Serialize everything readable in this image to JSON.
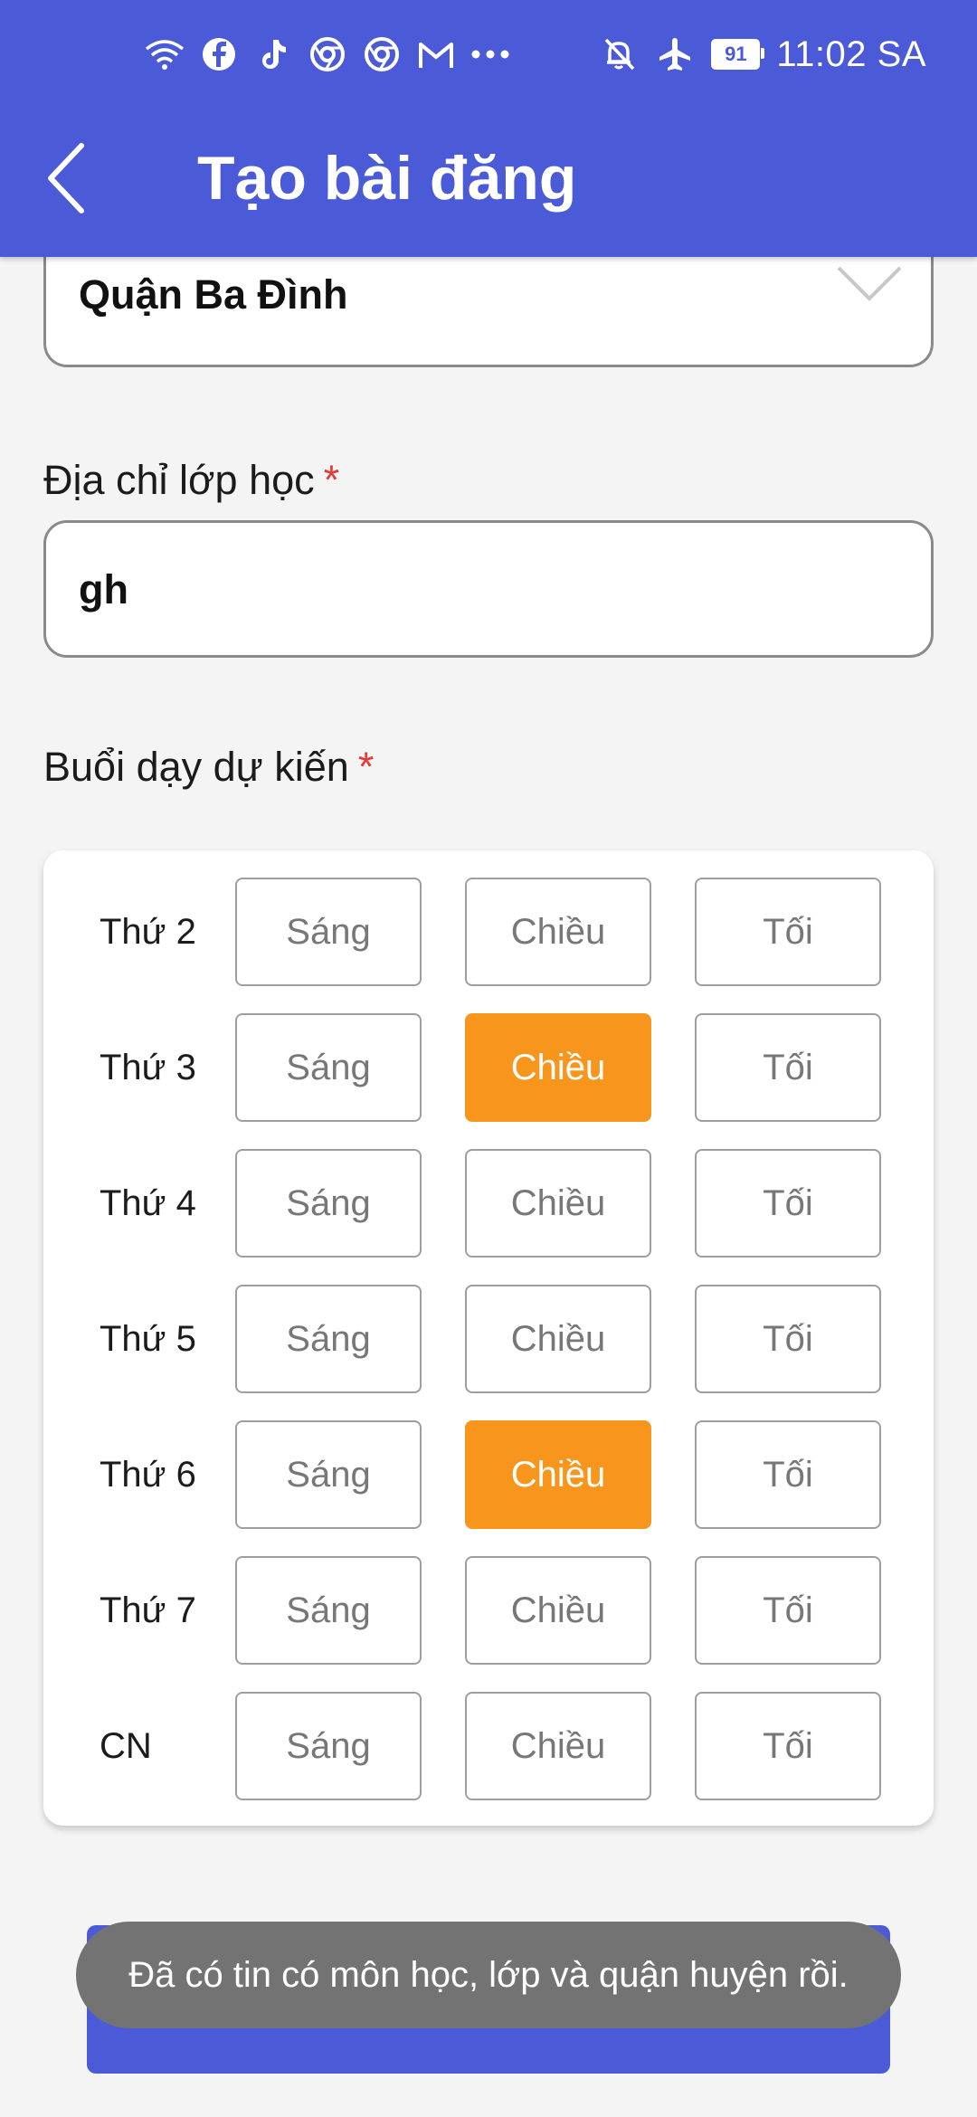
{
  "status_bar": {
    "left_icons": [
      "wifi-icon",
      "facebook-icon",
      "tiktok-icon",
      "chrome-icon",
      "chrome-icon",
      "gmail-icon",
      "more-dots-icon"
    ],
    "right_icons": [
      "notifications-off-icon",
      "airplane-mode-icon"
    ],
    "battery": "91",
    "time": "11:02 SA"
  },
  "appbar": {
    "title": "Tạo bài đăng",
    "back_icon": "chevron-left-icon"
  },
  "colors": {
    "primary": "#4b5ad6",
    "selected": "#f7951d",
    "required": "#e53935"
  },
  "district": {
    "value": "Quận Ba Đình"
  },
  "address": {
    "label": "Địa chỉ lớp học",
    "required_mark": "*",
    "value": "gh"
  },
  "schedule": {
    "label": "Buổi dạy dự kiến",
    "required_mark": "*",
    "slot_labels": [
      "Sáng",
      "Chiều",
      "Tối"
    ],
    "rows": [
      {
        "day": "Thứ 2",
        "slots": [
          {
            "label": "Sáng",
            "selected": false
          },
          {
            "label": "Chiều",
            "selected": false
          },
          {
            "label": "Tối",
            "selected": false
          }
        ]
      },
      {
        "day": "Thứ 3",
        "slots": [
          {
            "label": "Sáng",
            "selected": false
          },
          {
            "label": "Chiều",
            "selected": true
          },
          {
            "label": "Tối",
            "selected": false
          }
        ]
      },
      {
        "day": "Thứ 4",
        "slots": [
          {
            "label": "Sáng",
            "selected": false
          },
          {
            "label": "Chiều",
            "selected": false
          },
          {
            "label": "Tối",
            "selected": false
          }
        ]
      },
      {
        "day": "Thứ 5",
        "slots": [
          {
            "label": "Sáng",
            "selected": false
          },
          {
            "label": "Chiều",
            "selected": false
          },
          {
            "label": "Tối",
            "selected": false
          }
        ]
      },
      {
        "day": "Thứ 6",
        "slots": [
          {
            "label": "Sáng",
            "selected": false
          },
          {
            "label": "Chiều",
            "selected": true
          },
          {
            "label": "Tối",
            "selected": false
          }
        ]
      },
      {
        "day": "Thứ 7",
        "slots": [
          {
            "label": "Sáng",
            "selected": false
          },
          {
            "label": "Chiều",
            "selected": false
          },
          {
            "label": "Tối",
            "selected": false
          }
        ]
      },
      {
        "day": "CN",
        "slots": [
          {
            "label": "Sáng",
            "selected": false
          },
          {
            "label": "Chiều",
            "selected": false
          },
          {
            "label": "Tối",
            "selected": false
          }
        ]
      }
    ]
  },
  "toast": {
    "message": "Đã có tin có môn học, lớp và quận huyện rồi."
  }
}
